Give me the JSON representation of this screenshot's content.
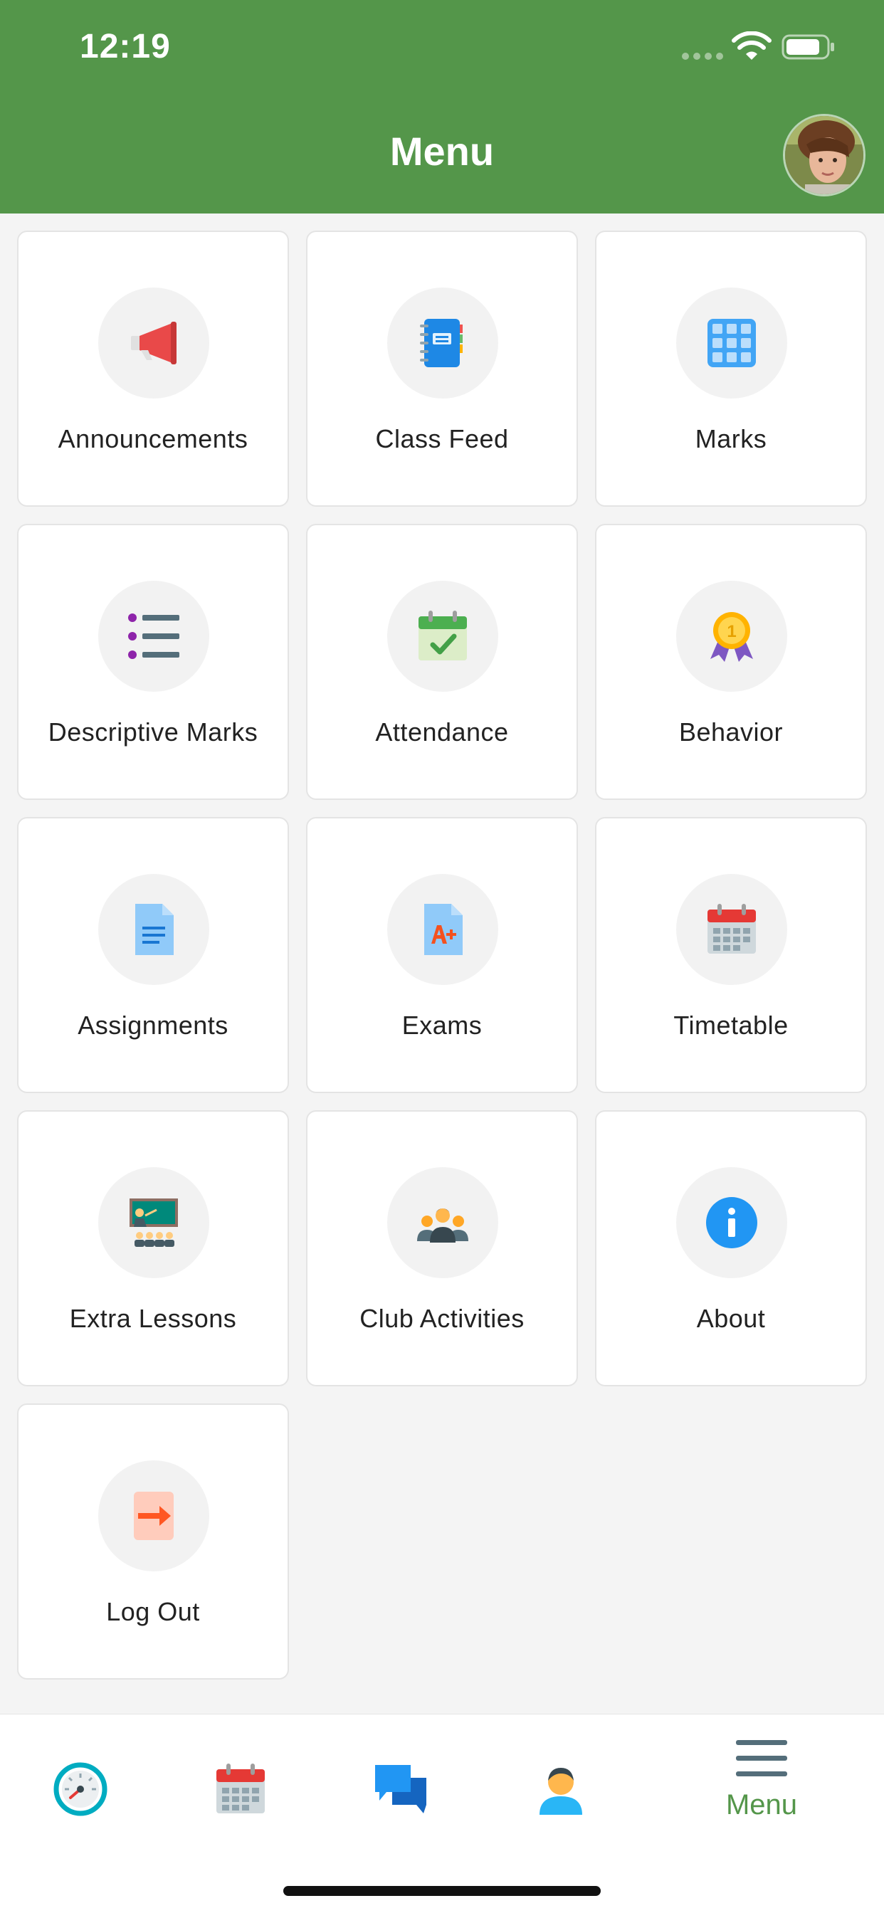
{
  "status_bar": {
    "time": "12:19"
  },
  "header": {
    "title": "Menu"
  },
  "tiles": [
    {
      "label": "Announcements",
      "icon": "megaphone-icon"
    },
    {
      "label": "Class Feed",
      "icon": "notebook-icon"
    },
    {
      "label": "Marks",
      "icon": "grid-icon"
    },
    {
      "label": "Descriptive Marks",
      "icon": "list-icon"
    },
    {
      "label": "Attendance",
      "icon": "calendar-check-icon"
    },
    {
      "label": "Behavior",
      "icon": "medal-icon"
    },
    {
      "label": "Assignments",
      "icon": "document-icon"
    },
    {
      "label": "Exams",
      "icon": "grade-document-icon"
    },
    {
      "label": "Timetable",
      "icon": "calendar-icon"
    },
    {
      "label": "Extra Lessons",
      "icon": "classroom-icon"
    },
    {
      "label": "Club Activities",
      "icon": "group-icon"
    },
    {
      "label": "About",
      "icon": "info-icon"
    },
    {
      "label": "Log Out",
      "icon": "logout-icon"
    }
  ],
  "tabbar": {
    "items": [
      {
        "icon": "speedometer-icon"
      },
      {
        "icon": "calendar-icon"
      },
      {
        "icon": "chat-icon"
      },
      {
        "icon": "person-icon"
      }
    ],
    "active_label": "Menu"
  },
  "colors": {
    "brand_green": "#54964a",
    "background": "#f4f4f4"
  }
}
